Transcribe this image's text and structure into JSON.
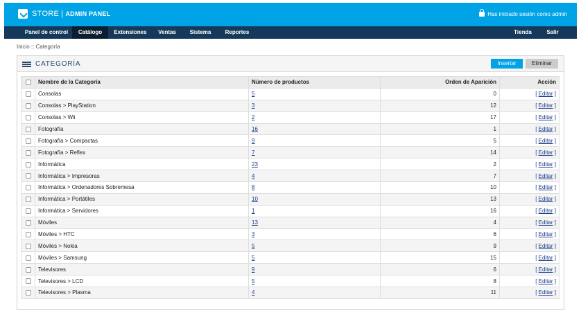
{
  "header": {
    "brand_store": "STORE",
    "brand_separator": "|",
    "brand_panel": "ADMIN PANEL",
    "login_status": "Has iniciado sesión como admin"
  },
  "nav": {
    "left": [
      {
        "label": "Panel de control",
        "active": false
      },
      {
        "label": "Catálogo",
        "active": true
      },
      {
        "label": "Extensiones",
        "active": false
      },
      {
        "label": "Ventas",
        "active": false
      },
      {
        "label": "Sistema",
        "active": false
      },
      {
        "label": "Reportes",
        "active": false
      }
    ],
    "right": [
      {
        "label": "Tienda"
      },
      {
        "label": "Salir"
      }
    ]
  },
  "breadcrumb": "Inicio :: Categoría",
  "panel": {
    "title": "Categoría",
    "insert_label": "Insertar",
    "delete_label": "Eliminar"
  },
  "table": {
    "headers": {
      "name": "Nombre de la Categoría",
      "products": "Número de productos",
      "order": "Orden de Aparición",
      "action": "Acción"
    },
    "edit_prefix": "[ ",
    "edit_label": "Editar",
    "edit_suffix": " ]",
    "rows": [
      {
        "name": "Consolas",
        "products": "5",
        "order": "0"
      },
      {
        "name": "Consolas > PlayStation",
        "products": "3",
        "order": "12"
      },
      {
        "name": "Consolas > Wii",
        "products": "2",
        "order": "17"
      },
      {
        "name": "Fotografía",
        "products": "16",
        "order": "1"
      },
      {
        "name": "Fotografía > Compactas",
        "products": "9",
        "order": "5"
      },
      {
        "name": "Fotografía > Reflex",
        "products": "7",
        "order": "14"
      },
      {
        "name": "Informática",
        "products": "23",
        "order": "2"
      },
      {
        "name": "Informática > Impresoras",
        "products": "4",
        "order": "7"
      },
      {
        "name": "Informática > Ordenadores Sobremesa",
        "products": "8",
        "order": "10"
      },
      {
        "name": "Informática > Portátiles",
        "products": "10",
        "order": "13"
      },
      {
        "name": "Informática > Servidores",
        "products": "1",
        "order": "16"
      },
      {
        "name": "Móviles",
        "products": "13",
        "order": "4"
      },
      {
        "name": "Móviles > HTC",
        "products": "3",
        "order": "6"
      },
      {
        "name": "Móviles > Nokia",
        "products": "5",
        "order": "9"
      },
      {
        "name": "Móviles > Samsung",
        "products": "5",
        "order": "15"
      },
      {
        "name": "Televisores",
        "products": "9",
        "order": "6"
      },
      {
        "name": "Televisores > LCD",
        "products": "5",
        "order": "8"
      },
      {
        "name": "Televisores > Plasma",
        "products": "4",
        "order": "11"
      }
    ]
  },
  "colors": {
    "topbar": "#00a3e6",
    "navbar": "#14395a",
    "nav_active": "#0b1e30",
    "insert_button": "#00a3e6",
    "delete_button": "#cccccc",
    "link": "#1a3b8a"
  },
  "icons": {
    "logo": "logo-icon",
    "lock": "lock-icon",
    "list": "list-icon",
    "checkbox": "checkbox-icon"
  }
}
